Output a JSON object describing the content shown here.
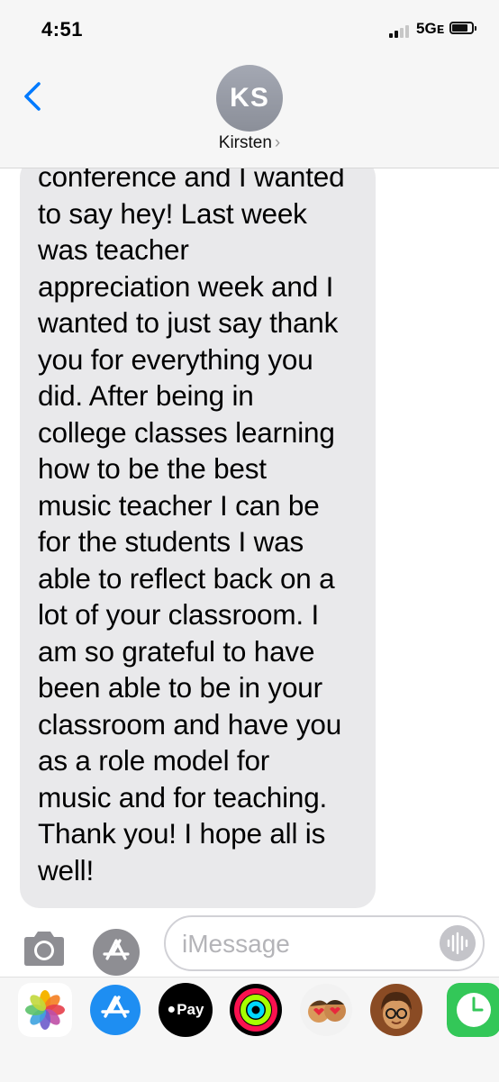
{
  "status_bar": {
    "time": "4:51",
    "network": "5Gᴇ",
    "battery_level": 0.72
  },
  "header": {
    "back_icon": "chevron-left-icon",
    "avatar_initials": "KS",
    "contact_name": "Kirsten",
    "contact_chevron": "›"
  },
  "conversation": {
    "messages": [
      {
        "direction": "incoming",
        "text": "conference and I wanted\nto say hey! Last week\nwas teacher\nappreciation week and I\nwanted to just say thank\nyou for everything you\ndid. After being in\ncollege classes learning\nhow to be the best\nmusic teacher I can be\nfor the students I was\nable to reflect back on a\nlot of your classroom. I\nam so grateful to have\nbeen able to be in your\nclassroom and have you\nas a role model for\nmusic and for teaching.\nThank you! I hope all is\nwell!"
      }
    ]
  },
  "input_bar": {
    "camera_icon": "camera-icon",
    "apps_icon": "app-store-icon",
    "placeholder": "iMessage",
    "audio_icon": "audio-waveform-icon"
  },
  "app_drawer": {
    "apps": [
      {
        "icon": "photos-icon"
      },
      {
        "icon": "app-store-icon"
      },
      {
        "icon": "apple-pay-icon",
        "label": "Pay"
      },
      {
        "icon": "activity-rings-icon"
      },
      {
        "icon": "memoji-stickers-icon"
      },
      {
        "icon": "memoji-icon"
      },
      {
        "icon": "clock-icon"
      }
    ]
  },
  "colors": {
    "accent": "#007aff",
    "incoming_bubble": "#e9e9eb",
    "bar_background": "#f6f6f6",
    "avatar": "#9a9ea8"
  }
}
